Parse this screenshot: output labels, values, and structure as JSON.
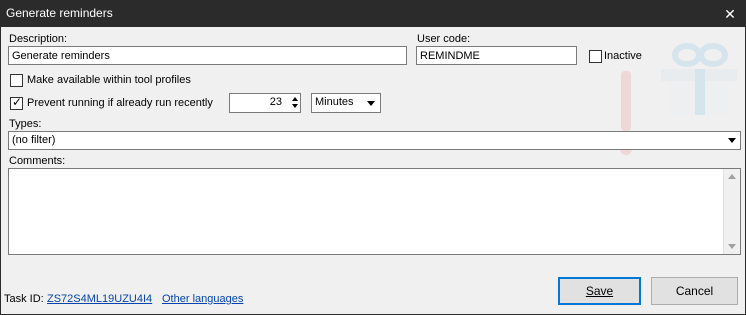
{
  "window": {
    "title": "Generate reminders",
    "close_glyph": "✕"
  },
  "form": {
    "description_label": "Description:",
    "description_value": "Generate reminders",
    "user_code_label": "User code:",
    "user_code_value": "REMINDME",
    "inactive_label": "Inactive",
    "inactive_checked": false,
    "make_available_label": "Make available within tool profiles",
    "make_available_checked": false,
    "prevent_label": "Prevent running if already run recently",
    "prevent_checked": true,
    "prevent_value": "23",
    "prevent_unit": "Minutes",
    "types_label": "Types:",
    "types_value": "(no filter)",
    "comments_label": "Comments:",
    "comments_value": ""
  },
  "footer": {
    "task_id_label": "Task ID:",
    "task_id_value": "ZS72S4ML19UZU4I4",
    "other_languages": "Other languages",
    "save_label": "Save",
    "cancel_label": "Cancel"
  },
  "watermark": {
    "icon": "gift-reminder-icon",
    "colors": [
      "#e8aaaa",
      "#a8d0ea"
    ]
  }
}
